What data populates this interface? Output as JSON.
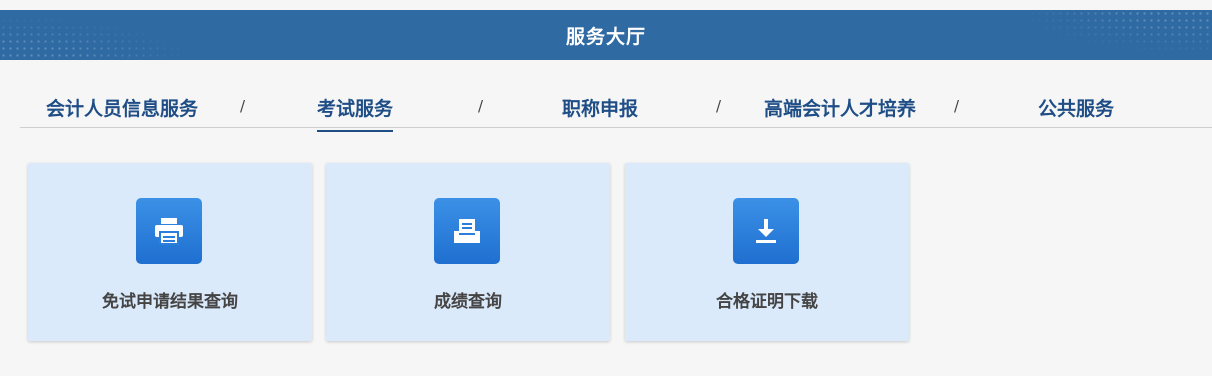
{
  "header": {
    "title": "服务大厅"
  },
  "tabs": [
    {
      "label": "会计人员信息服务"
    },
    {
      "label": "考试服务"
    },
    {
      "label": "职称申报"
    },
    {
      "label": "高端会计人才培养"
    },
    {
      "label": "公共服务"
    }
  ],
  "separator": "/",
  "active_tab": "考试服务",
  "cards": [
    {
      "label": "免试申请结果查询",
      "icon": "printer-icon"
    },
    {
      "label": "成绩查询",
      "icon": "tray-document-icon"
    },
    {
      "label": "合格证明下载",
      "icon": "download-icon"
    }
  ],
  "colors": {
    "header_bg": "#2f6aa3",
    "tab_text": "#1f4e86",
    "card_bg": "#dbeafb",
    "icon_bg": "#2b82dd"
  }
}
